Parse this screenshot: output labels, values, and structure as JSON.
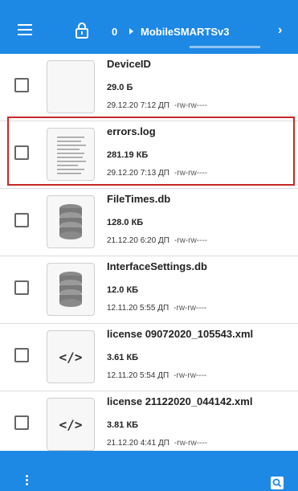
{
  "header": {
    "path_index": "0",
    "folder": "MobileSMARTSv3",
    "icons": {
      "menu": "menu-icon",
      "lock": "lock-icon",
      "forward": "chevron-right-icon"
    }
  },
  "files": [
    {
      "name": "DeviceID",
      "size": "29.0 Б",
      "date": "29.12.20 7:12 ДП",
      "perm": "-rw-rw----",
      "icon": "blank-file"
    },
    {
      "name": "errors.log",
      "size": "281.19 КБ",
      "date": "29.12.20 7:13 ДП",
      "perm": "-rw-rw----",
      "icon": "text-file",
      "highlighted": true
    },
    {
      "name": "FileTimes.db",
      "size": "128.0 КБ",
      "date": "21.12.20 6:20 ДП",
      "perm": "-rw-rw----",
      "icon": "database"
    },
    {
      "name": "InterfaceSettings.db",
      "size": "12.0 КБ",
      "date": "12.11.20 5:55 ДП",
      "perm": "-rw-rw----",
      "icon": "database"
    },
    {
      "name": "license 09072020_105543.xml",
      "size": "3.61 КБ",
      "date": "12.11.20 5:54 ДП",
      "perm": "-rw-rw----",
      "icon": "code",
      "code_glyph": "</>"
    },
    {
      "name": "license 21122020_044142.xml",
      "size": "3.81 КБ",
      "date": "21.12.20 4:41 ДП",
      "perm": "-rw-rw----",
      "icon": "code",
      "code_glyph": "</>"
    }
  ],
  "footer": {
    "icons": {
      "more": "more-vert-icon",
      "search": "search-icon"
    }
  },
  "colors": {
    "primary": "#1e88e5",
    "highlight": "#c62828"
  }
}
